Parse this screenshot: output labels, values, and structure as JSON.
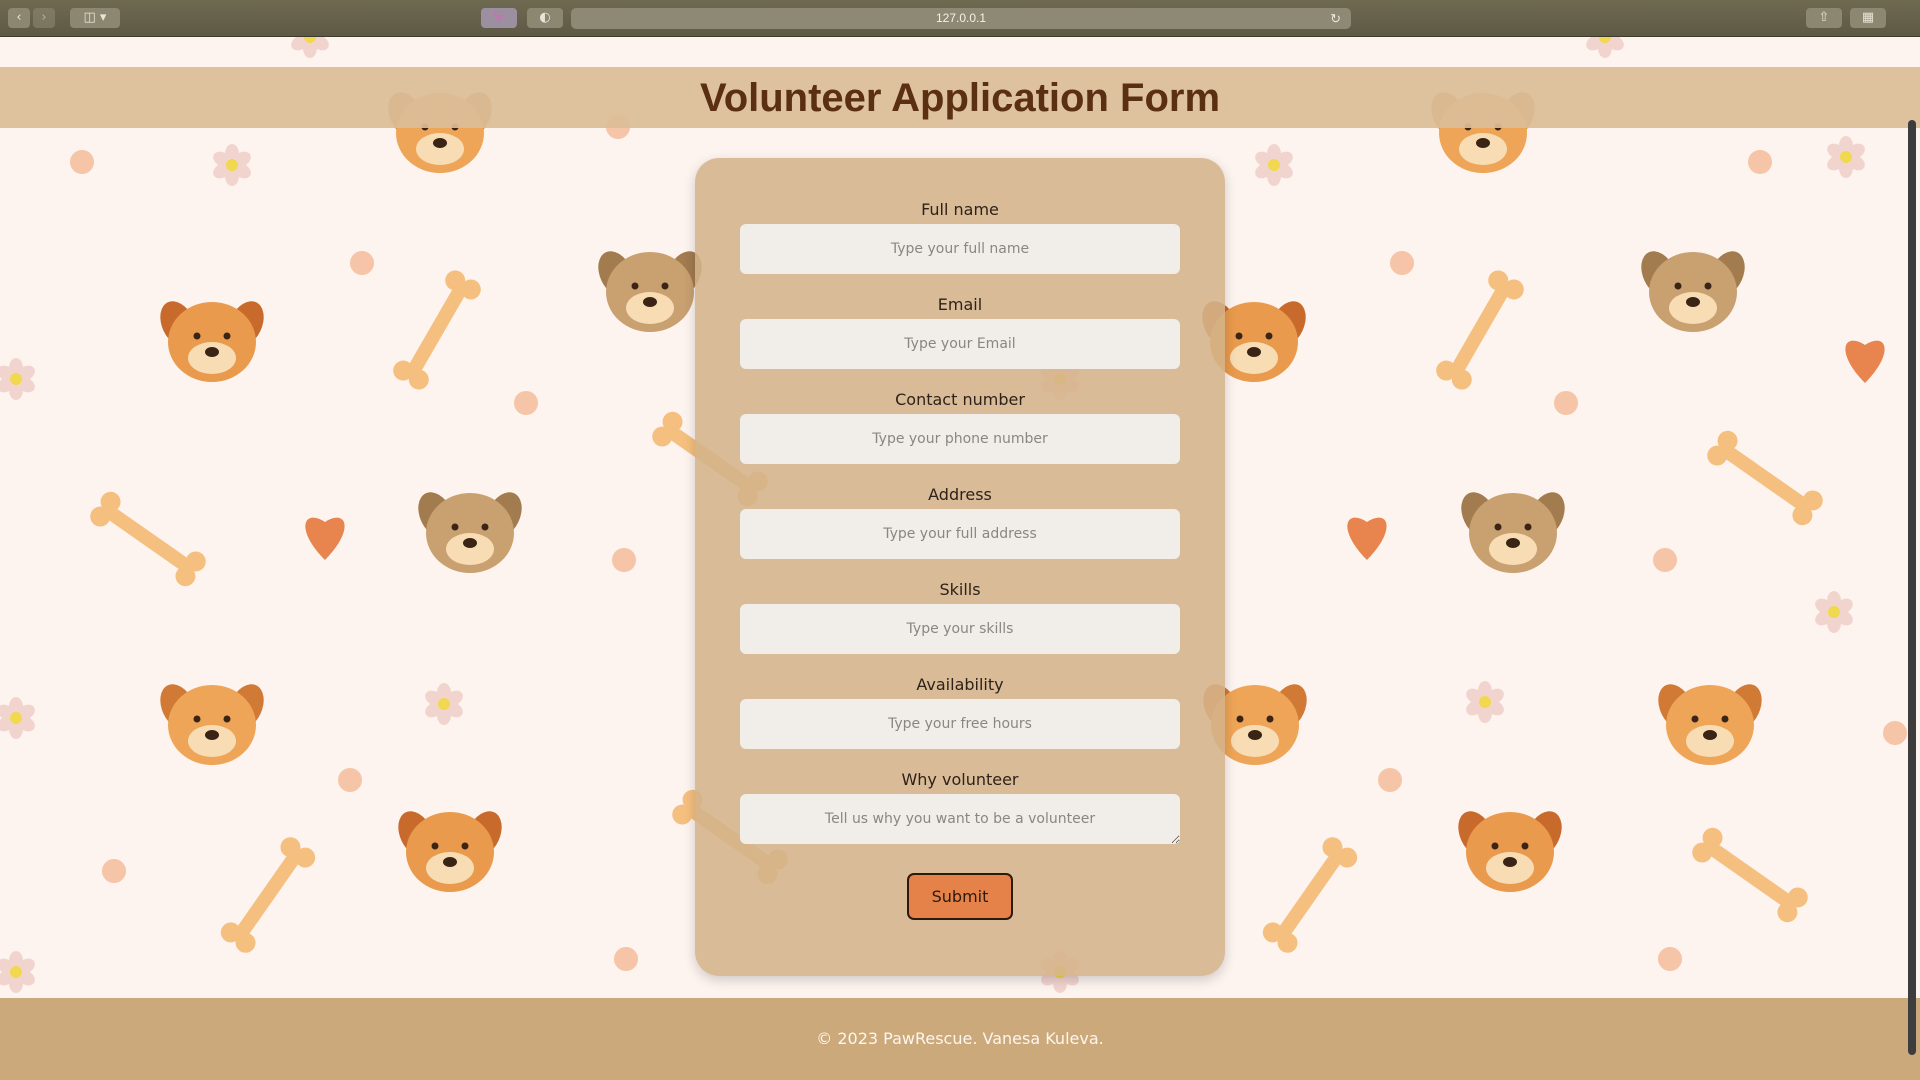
{
  "browser": {
    "url": "127.0.0.1",
    "back_icon": "chevron-left-icon",
    "forward_icon": "chevron-right-icon",
    "sidebar_icon": "sidebar-icon",
    "shield_icon": "shield-icon",
    "reader_icon": "contrast-icon",
    "share_icon": "share-icon",
    "tabs_icon": "grid-icon",
    "reload_icon": "reload-icon"
  },
  "header": {
    "title": "Volunteer Application Form"
  },
  "form": {
    "fields": [
      {
        "label": "Full name",
        "placeholder": "Type your full name"
      },
      {
        "label": "Email",
        "placeholder": "Type your Email"
      },
      {
        "label": "Contact number",
        "placeholder": "Type your phone number"
      },
      {
        "label": "Address",
        "placeholder": "Type your full address"
      },
      {
        "label": "Skills",
        "placeholder": "Type your skills"
      },
      {
        "label": "Availability",
        "placeholder": "Type your free hours"
      },
      {
        "label": "Why volunteer",
        "placeholder": "Tell us why you want to be a volunteer"
      }
    ],
    "submit_label": "Submit"
  },
  "footer": {
    "text": "© 2023 PawRescue. Vanesa Kuleva."
  },
  "colors": {
    "background": "#fdf4f0",
    "header_bg": "#dbbd98",
    "card_bg": "#d4b38a",
    "input_bg": "#f1ede9",
    "submit_bg": "#e4824a",
    "footer_bg": "#cca97a",
    "title_color": "#5a2f12"
  }
}
